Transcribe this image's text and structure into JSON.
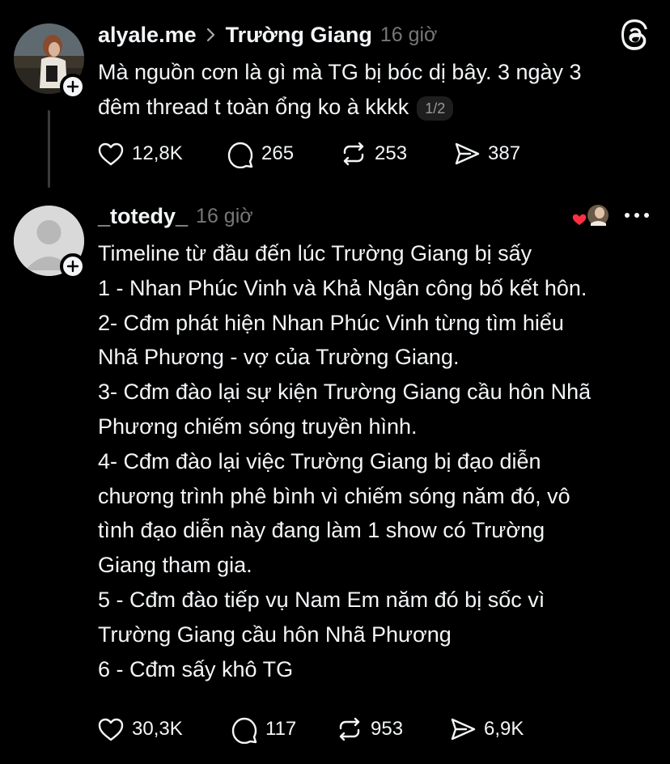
{
  "post1": {
    "username": "alyale.me",
    "reply_to": "Trường Giang",
    "time": "16 giờ",
    "lines": [
      "Mà nguồn cơn là gì mà TG bị bóc dị bây. 3 ngày 3",
      "đêm thread t toàn ổng ko à kkkk"
    ],
    "page_badge": "1/2",
    "actions": {
      "likes": "12,8K",
      "replies": "265",
      "reposts": "253",
      "shares": "387"
    }
  },
  "post2": {
    "username": "_totedy_",
    "time": "16 giờ",
    "lines": [
      "Timeline từ đầu đến lúc Trường Giang bị sấy",
      "1 - Nhan Phúc Vinh và Khả Ngân công bố kết hôn.",
      "2- Cđm phát hiện Nhan Phúc Vinh từng tìm hiểu",
      "Nhã Phương - vợ của Trường Giang.",
      "3- Cđm đào lại sự kiện Trường Giang cầu hôn Nhã",
      "Phương chiếm sóng truyền hình.",
      "4- Cđm đào lại việc Trường Giang bị đạo diễn",
      "chương trình phê bình vì chiếm sóng năm đó, vô",
      "tình đạo diễn này đang làm 1 show có Trường",
      "Giang tham gia.",
      "5 - Cđm đào tiếp vụ Nam Em năm đó bị sốc vì",
      "Trường Giang cầu hôn Nhã Phương",
      "6 - Cđm sấy khô TG"
    ],
    "actions": {
      "likes": "30,3K",
      "replies": "117",
      "reposts": "953",
      "shares": "6,9K"
    }
  },
  "colors": {
    "background": "#000000",
    "text": "#f3f5f7",
    "muted": "#777777",
    "heart": "#ff3040"
  }
}
